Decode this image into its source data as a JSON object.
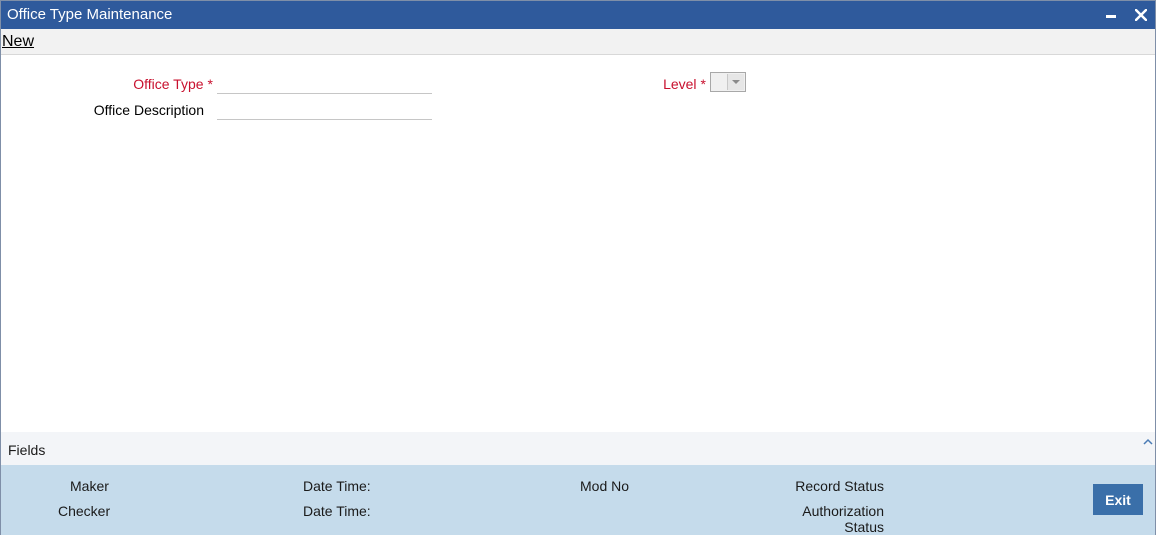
{
  "window": {
    "title": "Office Type Maintenance",
    "minimize_icon": "minimize-icon",
    "close_icon": "close-icon"
  },
  "menu": {
    "new_label": "New"
  },
  "form": {
    "office_type": {
      "label": "Office Type",
      "required_mark": "*",
      "value": ""
    },
    "office_description": {
      "label": "Office Description",
      "value": ""
    },
    "level": {
      "label": "Level",
      "required_mark": "*",
      "selected": ""
    }
  },
  "fields_section": {
    "label": "Fields",
    "toggle_icon": "chevron-up-icon"
  },
  "audit": {
    "maker_label": "Maker",
    "checker_label": "Checker",
    "maker_datetime_label": "Date Time:",
    "checker_datetime_label": "Date Time:",
    "mod_no_label": "Mod No",
    "record_status_label": "Record Status",
    "authorization_status_label_line1": "Authorization",
    "authorization_status_label_line2": "Status",
    "exit_label": "Exit"
  },
  "colors": {
    "titlebar": "#2f5a9c",
    "required_label": "#c8102e",
    "footer": "#c5dbeb",
    "exit_button": "#3a6fa9"
  }
}
